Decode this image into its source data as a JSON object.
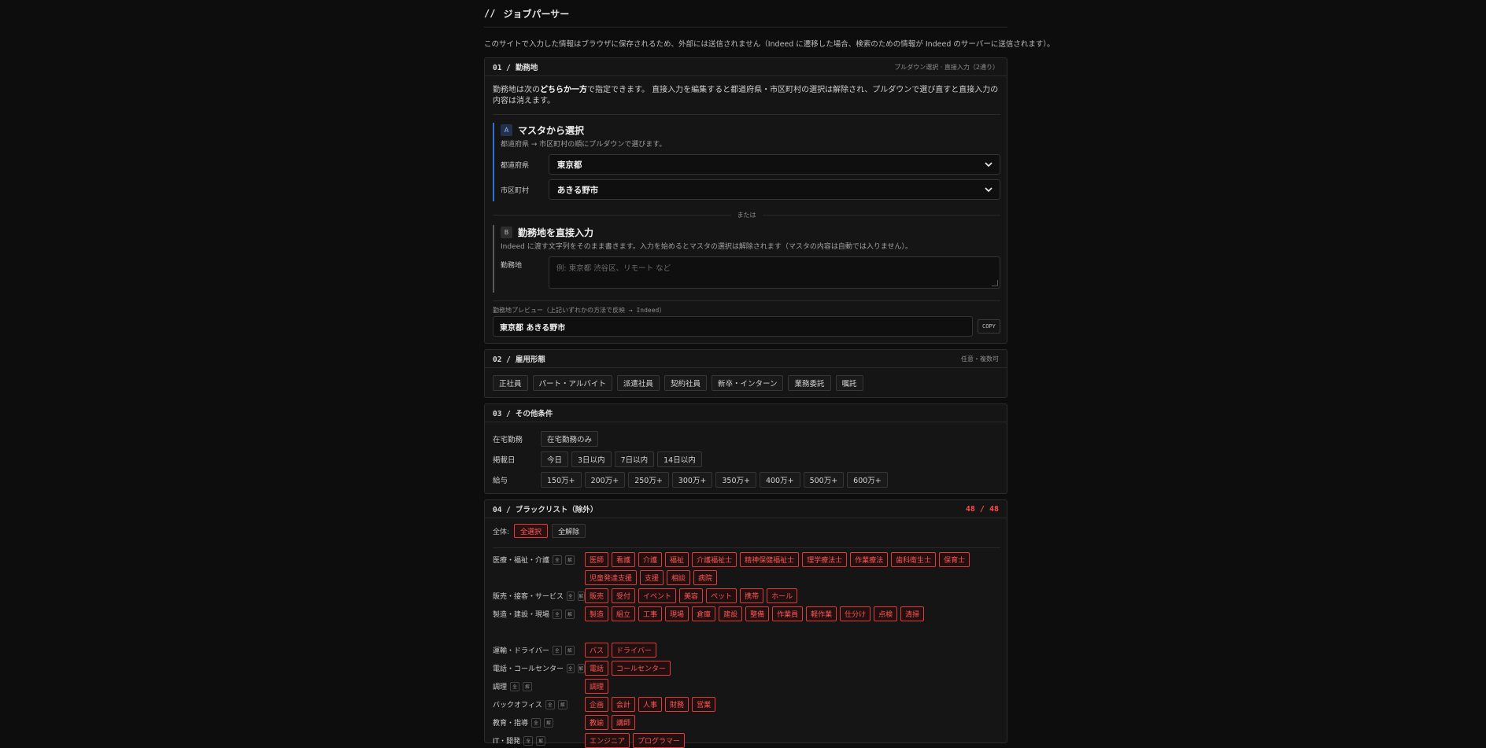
{
  "app": {
    "slashes": "//",
    "title": "ジョブパーサー",
    "notice": "このサイトで入力した情報はブラウザに保存されるため、外部には送信されません（Indeed に遷移した場合、検索のための情報が Indeed のサーバーに送信されます）。"
  },
  "location": {
    "num": "01 /",
    "title": "勤務地",
    "hint": "プルダウン選択 · 直接入力（2通り）",
    "intro_pre": "勤務地は次の",
    "intro_bold": "どちらか一方",
    "intro_post": "で指定できます。 直接入力を編集すると都道府県・市区町村の選択は解除され、プルダウンで選び直すと直接入力の内容は消えます。",
    "option_a": {
      "badge": "A",
      "title": "マスタから選択",
      "desc": "都道府県 → 市区町村の順にプルダウンで選びます。",
      "pref_label": "都道府県",
      "pref_value": "東京都",
      "city_label": "市区町村",
      "city_value": "あきる野市"
    },
    "or_label": "または",
    "option_b": {
      "badge": "B",
      "title": "勤務地を直接入力",
      "desc": "Indeed に渡す文字列をそのまま書きます。入力を始めるとマスタの選択は解除されます（マスタの内容は自動では入りません）。",
      "field_label": "勤務地",
      "placeholder": "例: 東京都 渋谷区、リモート など"
    },
    "preview_label": "勤務地プレビュー（上記いずれかの方法で反映 → Indeed）",
    "preview_value": "東京都 あきる野市",
    "copy_label": "COPY"
  },
  "employment": {
    "num": "02 /",
    "title": "雇用形態",
    "hint": "任意・複数可",
    "options": [
      "正社員",
      "パート・アルバイト",
      "派遣社員",
      "契約社員",
      "新卒・インターン",
      "業務委託",
      "嘱託"
    ]
  },
  "other": {
    "num": "03 /",
    "title": "その他条件",
    "remote_label": "在宅勤務",
    "remote_options": [
      "在宅勤務のみ"
    ],
    "posted_label": "掲載日",
    "posted_options": [
      "今日",
      "3日以内",
      "7日以内",
      "14日以内"
    ],
    "salary_label": "給与",
    "salary_options": [
      "150万+",
      "200万+",
      "250万+",
      "300万+",
      "350万+",
      "400万+",
      "500万+",
      "600万+"
    ]
  },
  "blacklist": {
    "num": "04 /",
    "title": "ブラックリスト（除外）",
    "count": "48 / 48",
    "all_label": "全体:",
    "select_all": "全選択",
    "clear_all": "全解除",
    "mini_all": "全",
    "mini_clear": "解",
    "categories": [
      {
        "name": "医療・福祉・介護",
        "tags": [
          "医師",
          "看護",
          "介護",
          "福祉",
          "介護福祉士",
          "精神保健福祉士",
          "理学療法士",
          "作業療法",
          "歯科衛生士",
          "保育士",
          "児童発達支援",
          "支援",
          "相談",
          "病院"
        ]
      },
      {
        "name": "販売・接客・サービス",
        "tags": [
          "販売",
          "受付",
          "イベント",
          "美容",
          "ペット",
          "携帯",
          "ホール"
        ]
      },
      {
        "name": "製造・建設・現場",
        "tags": [
          "製造",
          "組立",
          "工事",
          "現場",
          "倉庫",
          "建設",
          "整備",
          "作業員",
          "軽作業",
          "仕分け",
          "点検",
          "清掃"
        ]
      },
      {
        "name": "運輸・ドライバー",
        "tags": [
          "バス",
          "ドライバー"
        ]
      },
      {
        "name": "電話・コールセンター",
        "tags": [
          "電話",
          "コールセンター"
        ]
      },
      {
        "name": "調理",
        "tags": [
          "調理"
        ]
      },
      {
        "name": "バックオフィス",
        "tags": [
          "企画",
          "会計",
          "人事",
          "財務",
          "営業"
        ]
      },
      {
        "name": "教育・指導",
        "tags": [
          "教諭",
          "講師"
        ]
      },
      {
        "name": "IT・開発",
        "tags": [
          "エンジニア",
          "プログラマー"
        ]
      }
    ]
  },
  "colors": {
    "accent_blue": "#2f6fcf",
    "danger_red": "#e03a3a",
    "background": "#0d0d0d"
  }
}
